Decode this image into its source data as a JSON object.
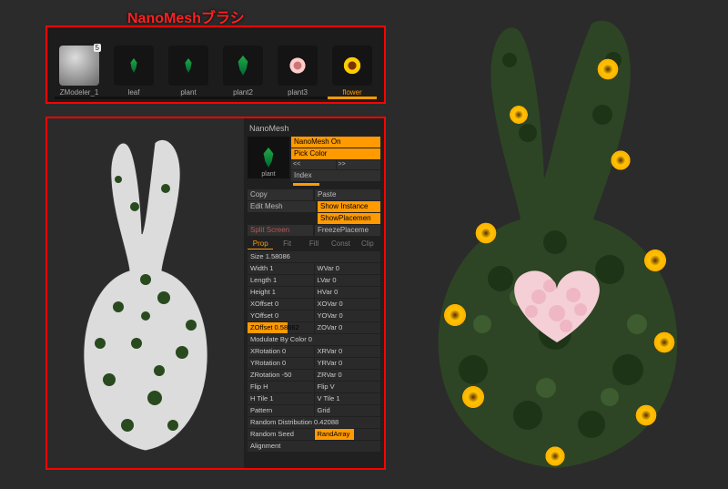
{
  "title": "NanoMeshブラシ",
  "brushes": [
    {
      "label": "ZModeler_1",
      "badge": "5",
      "kind": "cube"
    },
    {
      "label": "leaf",
      "kind": "leaf"
    },
    {
      "label": "plant",
      "kind": "leaf"
    },
    {
      "label": "plant2",
      "kind": "leaf"
    },
    {
      "label": "plant3",
      "kind": "flowerw"
    },
    {
      "label": "flower",
      "kind": "flowery",
      "selected": true
    }
  ],
  "panel": {
    "header": "NanoMesh",
    "preview_label": "plant",
    "toggle": "NanoMesh On",
    "pick_color": "Pick Color",
    "nav": {
      "prev": "<<",
      "next": ">>",
      "index": "Index"
    },
    "copy": "Copy",
    "paste": "Paste",
    "edit_mesh": "Edit Mesh",
    "show_instance": "Show Instance",
    "show_placement": "ShowPlacemen",
    "split_screen": "Split Screen",
    "freeze": "FreezePlaceme",
    "tabs": [
      "Prop",
      "Fit",
      "Fill",
      "Const",
      "Clip"
    ],
    "size": {
      "label": "Size",
      "value": "1.58086"
    },
    "rows": [
      {
        "l": "Width 1",
        "r": "WVar 0"
      },
      {
        "l": "Length 1",
        "r": "LVar 0"
      },
      {
        "l": "Height 1",
        "r": "HVar 0"
      },
      {
        "l": "XOffset 0",
        "r": "XOVar 0"
      },
      {
        "l": "YOffset 0",
        "r": "YOVar 0"
      },
      {
        "l": "ZOffset 0.58662",
        "r": "ZOVar 0",
        "hl": true
      },
      {
        "l": "Modulate By Color 0",
        "full": true
      },
      {
        "l": "XRotation 0",
        "r": "XRVar 0"
      },
      {
        "l": "YRotation 0",
        "r": "YRVar 0"
      },
      {
        "l": "ZRotation -50",
        "r": "ZRVar 0"
      },
      {
        "l": "Flip H",
        "r": "Flip V",
        "btn": true
      },
      {
        "l": "H Tile 1",
        "r": "V Tile 1"
      }
    ],
    "pattern": {
      "label": "Pattern",
      "value": "Grid"
    },
    "random_dist": {
      "label": "Random Distribution",
      "value": "0.42088"
    },
    "random_seed": "Random Seed",
    "rand_array": "RandArray",
    "alignment": "Alignment"
  }
}
